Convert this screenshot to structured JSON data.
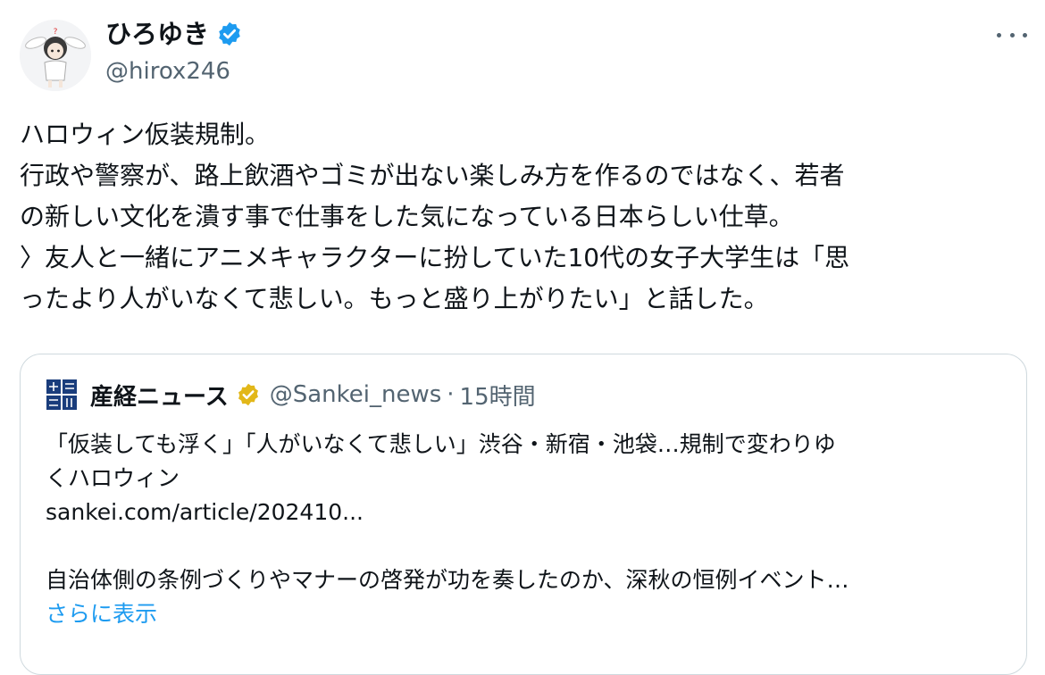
{
  "author": {
    "display_name": "ひろゆき",
    "handle": "@hirox246",
    "verified_badge_color": "#1d9bf0",
    "avatar_icon": "avatar-bunny-ears-character"
  },
  "more_icon": "ellipsis-icon",
  "tweet": {
    "lines": [
      "ハロウィン仮装規制。",
      "行政や警察が、路上飲酒やゴミが出ない楽しみ方を作るのではなく、若者",
      "の新しい文化を潰す事で仕事をした気になっている日本らしい仕草。",
      "〉友人と一緒にアニメキャラクターに扮していた10代の女子大学生は「思",
      "ったより人がいなくて悲しい。もっと盛り上がりたい」と話した。"
    ]
  },
  "quote": {
    "source_name": "産経ニュース",
    "source_handle": "@Sankei_news",
    "separator": "·",
    "time": "15時間",
    "verified_badge_color": "#e2b719",
    "logo_icon": "sankei-logo-icon",
    "headline_lines": [
      "「仮装しても浮く」「人がいなくて悲しい」渋谷・新宿・池袋…規制で変わりゆ",
      "くハロウィン"
    ],
    "link": "sankei.com/article/202410...",
    "summary": "自治体側の条例づくりやマナーの啓発が功を奏したのか、深秋の恒例イベント…",
    "show_more": "さらに表示"
  },
  "colors": {
    "text": "#0f1419",
    "secondary": "#536471",
    "link": "#1d9bf0",
    "border": "#cfd9de"
  }
}
